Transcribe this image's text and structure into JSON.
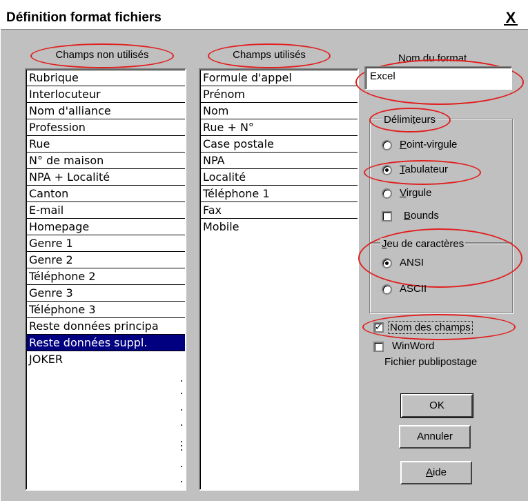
{
  "dialog": {
    "title": "Définition format fichiers",
    "close_symbol": "X"
  },
  "unused_fields": {
    "header": "Champs non utilisés",
    "items": [
      "Rubrique",
      "Interlocuteur",
      "Nom d'alliance",
      "Profession",
      "Rue",
      "N° de maison",
      "NPA + Localité",
      "Canton",
      "E-mail",
      "Homepage",
      "Genre 1",
      "Genre 2",
      "Téléphone 2",
      "Genre 3",
      "Téléphone 3",
      "Reste données principa",
      "Reste données suppl.",
      "JOKER"
    ],
    "selected": "Reste données suppl."
  },
  "used_fields": {
    "header": "Champs utilisés",
    "items": [
      "Formule d'appel",
      "Prénom",
      "Nom",
      "Rue + N°",
      "Case postale",
      "NPA",
      "Localité",
      "Téléphone 1",
      "Fax",
      "Mobile"
    ]
  },
  "format_name": {
    "label_accel": "N",
    "label_rest": "om du format",
    "value": "Excel"
  },
  "delimiters": {
    "legend_pre": "Délimi",
    "legend_accel": "t",
    "legend_post": "eurs",
    "options": [
      {
        "accel": "P",
        "rest": "oint-virgule",
        "selected": false
      },
      {
        "accel": "T",
        "rest": "abulateur",
        "selected": true
      },
      {
        "accel": "V",
        "rest": "irgule",
        "selected": false
      }
    ],
    "bounds": {
      "accel": "B",
      "rest": "ounds",
      "checked": false
    }
  },
  "charset": {
    "legend_accel": "J",
    "legend_rest": "eu de caractères",
    "options": [
      {
        "label": "ANSI",
        "selected": true
      },
      {
        "label": "ASCII",
        "selected": false
      }
    ]
  },
  "field_names": {
    "label": "Nom des champs",
    "checked": true
  },
  "winword": {
    "label_line1": "WinWord",
    "label_line2": "Fichier publipostage",
    "checked": false
  },
  "buttons": {
    "ok": "OK",
    "cancel": "Annuler",
    "help_accel": "A",
    "help_rest": "ide"
  },
  "annotation_color": "#e02020",
  "selection_color": "#000080"
}
